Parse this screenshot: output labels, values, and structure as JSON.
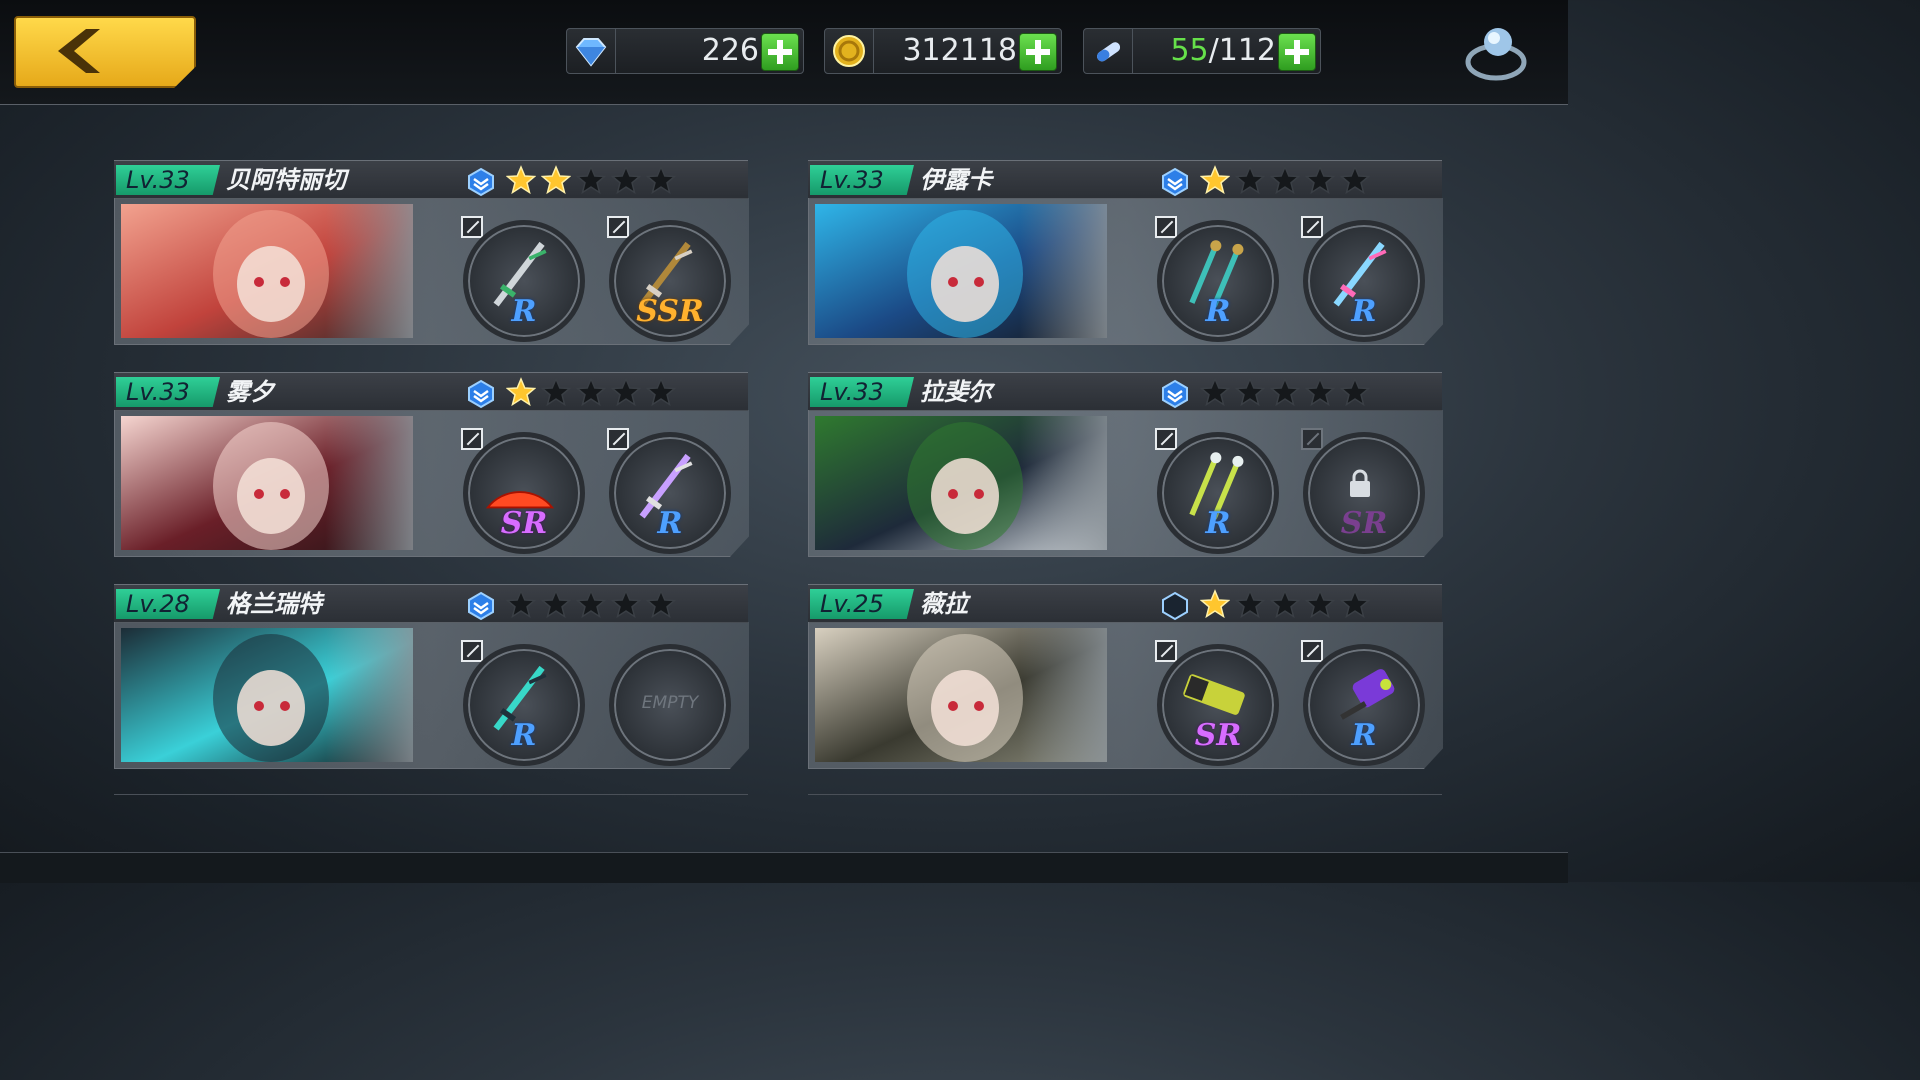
{
  "header": {
    "back_icon": "chevron-left-icon",
    "resources": [
      {
        "icon": "diamond-icon",
        "value": "226"
      },
      {
        "icon": "gold-coin-icon",
        "value": "312118"
      },
      {
        "icon": "stamina-capsule-icon",
        "current": "55",
        "max": "/112"
      }
    ],
    "ring_icon": "ring-icon"
  },
  "characters": [
    {
      "level": "Lv.33",
      "name": "贝阿特丽切",
      "stars": 2,
      "shield": "filled",
      "weapons": [
        {
          "rarity": "R",
          "type": "sword"
        },
        {
          "rarity": "SSR",
          "type": "katana"
        }
      ]
    },
    {
      "level": "Lv.33",
      "name": "伊露卡",
      "stars": 1,
      "shield": "filled",
      "weapons": [
        {
          "rarity": "R",
          "type": "twin-blades"
        },
        {
          "rarity": "R",
          "type": "crystal-blade"
        }
      ]
    },
    {
      "level": "Lv.33",
      "name": "雾夕",
      "stars": 1,
      "shield": "filled",
      "weapons": [
        {
          "rarity": "SR",
          "type": "fan"
        },
        {
          "rarity": "R",
          "type": "staff"
        }
      ]
    },
    {
      "level": "Lv.33",
      "name": "拉斐尔",
      "stars": 0,
      "shield": "filled",
      "weapons": [
        {
          "rarity": "R",
          "type": "twin-axes"
        },
        {
          "rarity": "SR",
          "type": "locked"
        }
      ]
    },
    {
      "level": "Lv.28",
      "name": "格兰瑞特",
      "stars": 0,
      "shield": "filled",
      "weapons": [
        {
          "rarity": "R",
          "type": "scythe"
        },
        {
          "rarity": "",
          "type": "empty",
          "empty_label": "EMPTY"
        }
      ]
    },
    {
      "level": "Lv.25",
      "name": "薇拉",
      "stars": 1,
      "shield": "outline",
      "weapons": [
        {
          "rarity": "SR",
          "type": "death-cannon"
        },
        {
          "rarity": "R",
          "type": "hammer"
        }
      ]
    }
  ],
  "colors": {
    "accent_green": "#2fcf97",
    "star_gold": "#ffc62e",
    "back_yellow": "#ffd94a",
    "plus_green": "#4cc437"
  }
}
